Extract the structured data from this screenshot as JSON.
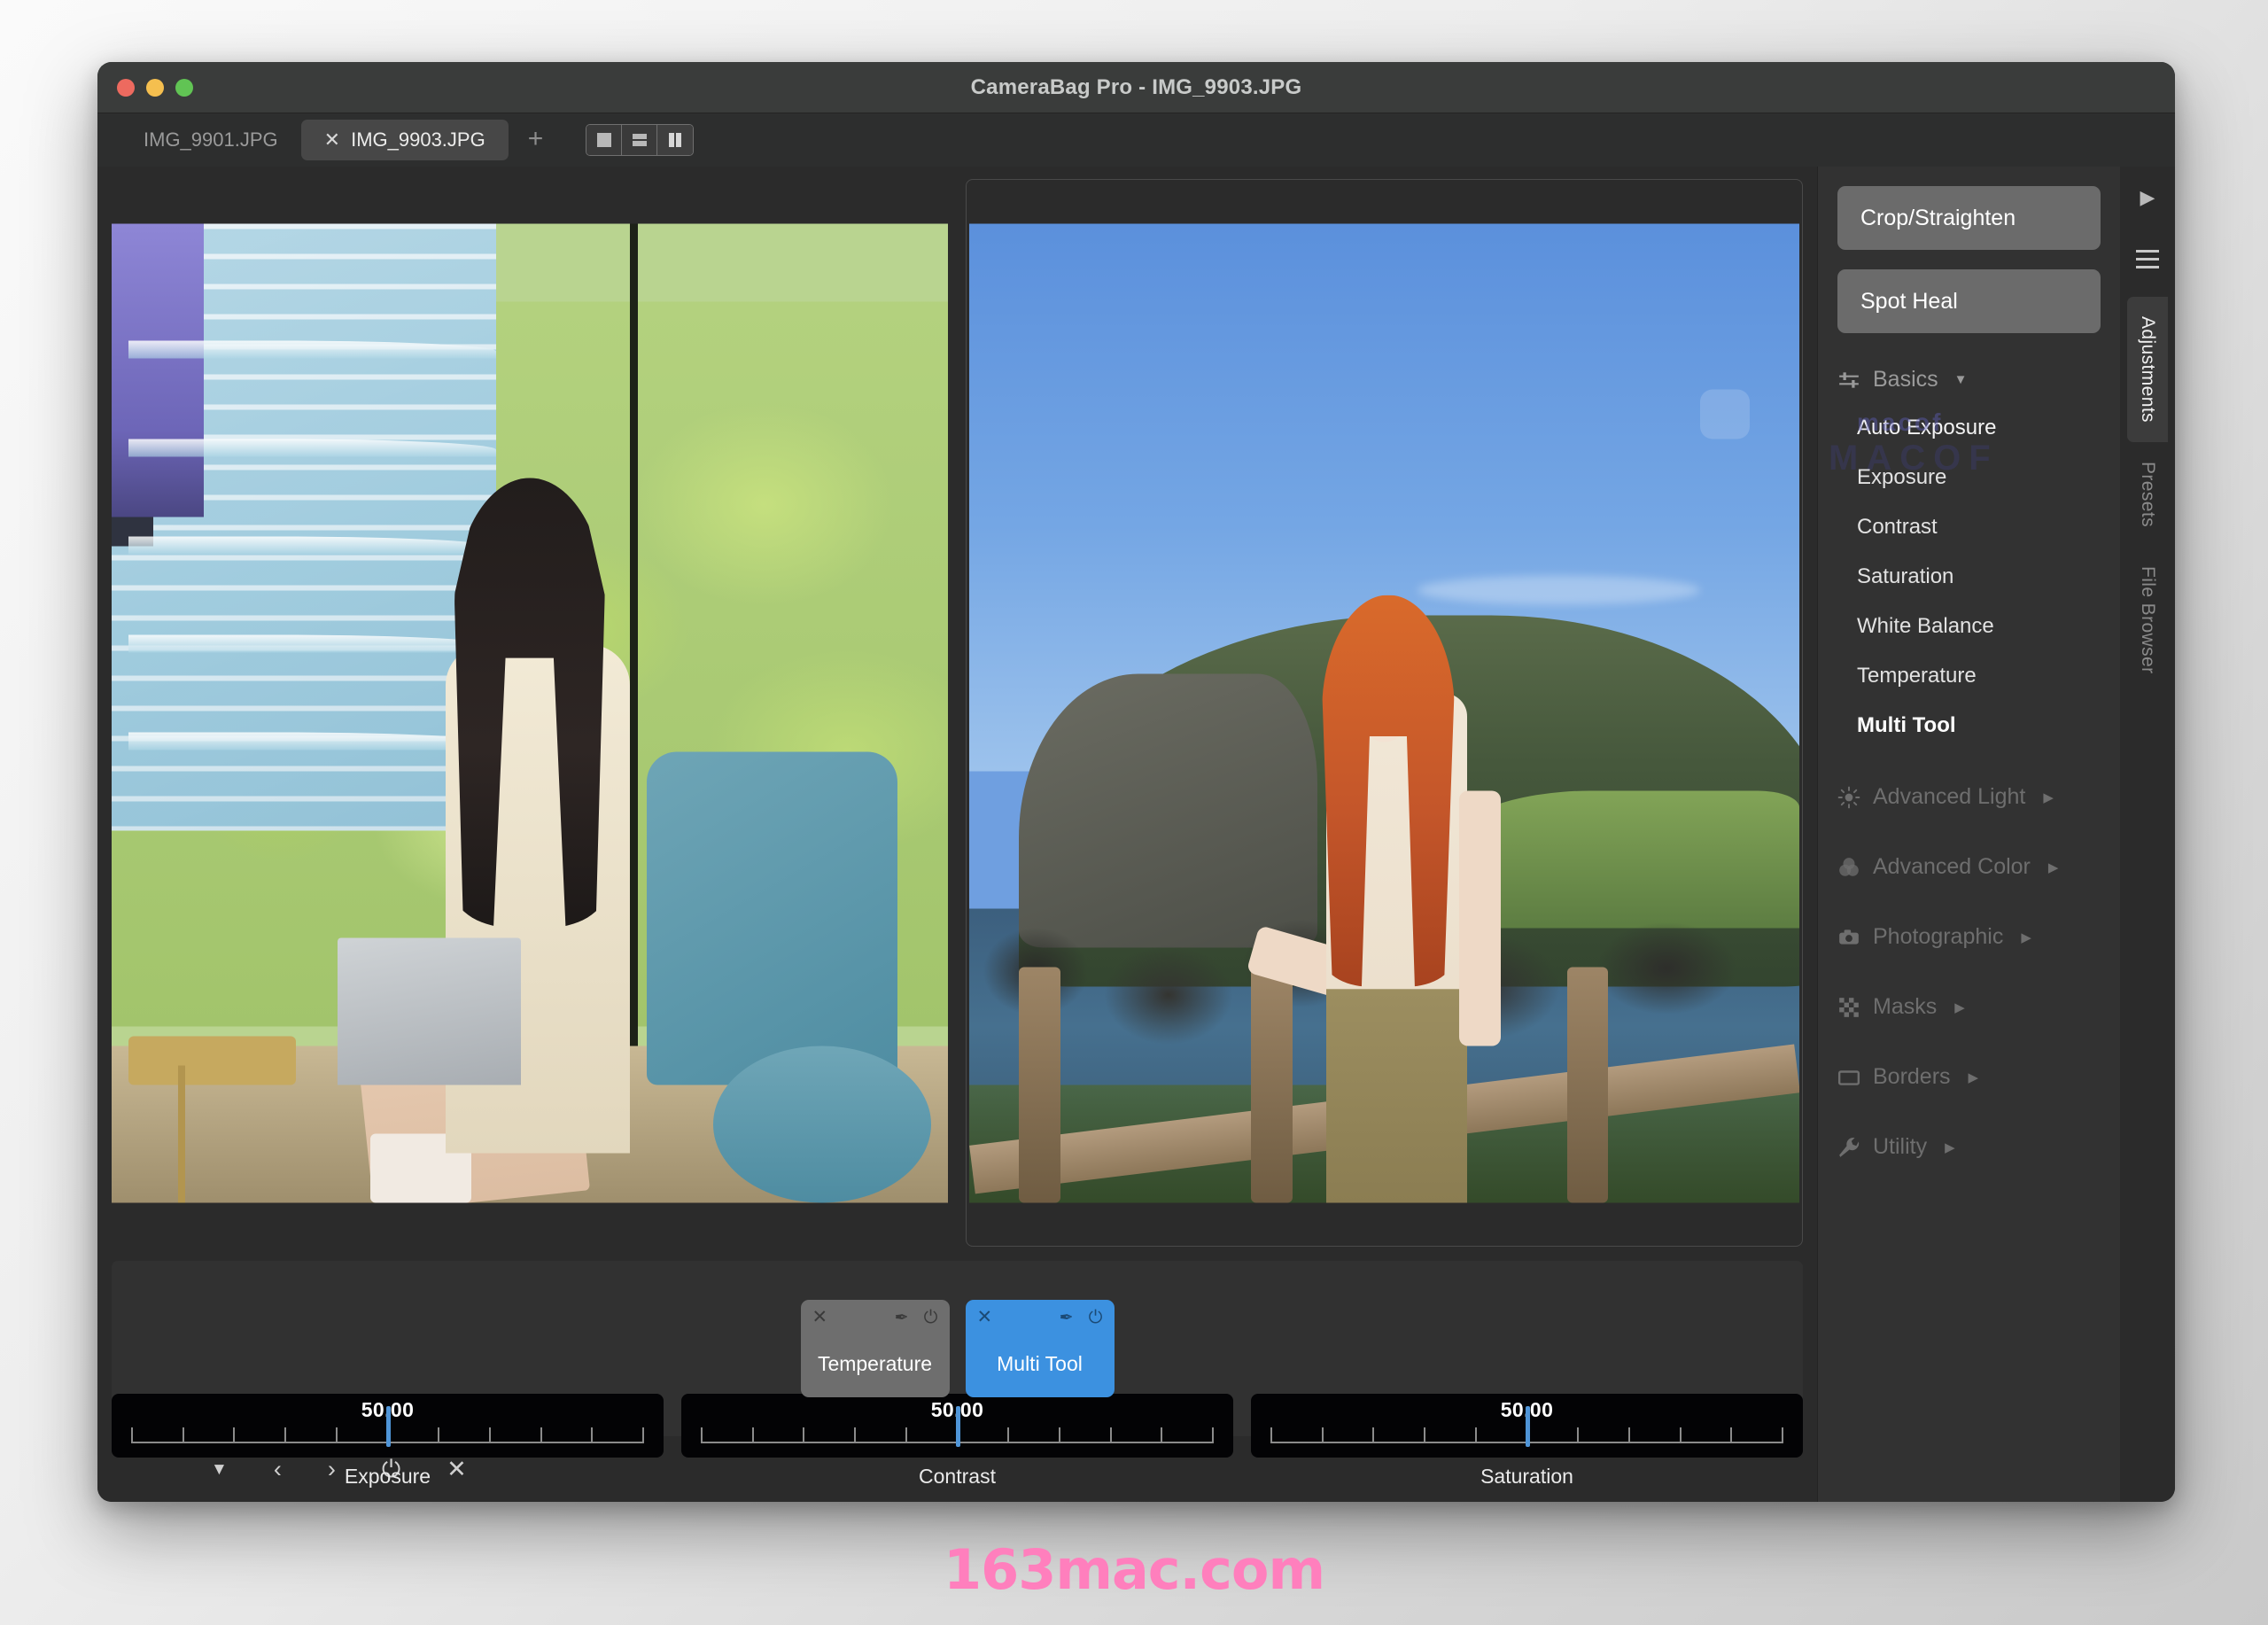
{
  "window": {
    "title": "CameraBag Pro - IMG_9903.JPG",
    "traffic_lights": {
      "close": "close",
      "minimize": "minimize",
      "maximize": "maximize"
    }
  },
  "tabs": {
    "items": [
      {
        "label": "IMG_9901.JPG",
        "active": false,
        "closable": false
      },
      {
        "label": "IMG_9903.JPG",
        "active": true,
        "closable": true,
        "close_glyph": "✕"
      }
    ],
    "add_label": "+",
    "layout_buttons": [
      {
        "name": "single-pane",
        "active": false
      },
      {
        "name": "horizontal-split",
        "active": false
      },
      {
        "name": "vertical-split",
        "active": true
      }
    ]
  },
  "sliders": [
    {
      "label": "Exposure",
      "value": "50.00",
      "position_pct": 50,
      "ticks": 11
    },
    {
      "label": "Contrast",
      "value": "50.00",
      "position_pct": 50,
      "ticks": 11
    },
    {
      "label": "Saturation",
      "value": "50.00",
      "position_pct": 50,
      "ticks": 11
    }
  ],
  "dock": {
    "chips": [
      {
        "label": "Temperature",
        "active": false,
        "close_glyph": "✕",
        "pin_glyph": "✒",
        "power_glyph": "⏻"
      },
      {
        "label": "Multi Tool",
        "active": true,
        "close_glyph": "✕",
        "pin_glyph": "✒",
        "power_glyph": "⏻"
      }
    ]
  },
  "bottom_bar": {
    "buttons": [
      {
        "name": "collapse-caret",
        "glyph": "▼"
      },
      {
        "name": "previous",
        "glyph": "‹"
      },
      {
        "name": "next",
        "glyph": "›"
      },
      {
        "name": "power-toggle",
        "glyph": "⏻"
      },
      {
        "name": "close",
        "glyph": "✕"
      }
    ]
  },
  "right_panel": {
    "tools": [
      {
        "label": "Crop/Straighten"
      },
      {
        "label": "Spot Heal"
      }
    ],
    "groups": [
      {
        "label": "Basics",
        "icon": "sliders-icon",
        "expanded": true,
        "caret": "▼",
        "items": [
          {
            "label": "Auto Exposure",
            "state": "accent",
            "watermark": "macof",
            "watermark2": "MACOF"
          },
          {
            "label": "Exposure",
            "state": "normal"
          },
          {
            "label": "Contrast",
            "state": "normal"
          },
          {
            "label": "Saturation",
            "state": "normal"
          },
          {
            "label": "White Balance",
            "state": "normal"
          },
          {
            "label": "Temperature",
            "state": "normal"
          },
          {
            "label": "Multi Tool",
            "state": "bold"
          }
        ]
      },
      {
        "label": "Advanced Light",
        "icon": "sun-icon",
        "expanded": false,
        "caret": "▶"
      },
      {
        "label": "Advanced Color",
        "icon": "color-circles-icon",
        "expanded": false,
        "caret": "▶"
      },
      {
        "label": "Photographic",
        "icon": "camera-icon",
        "expanded": false,
        "caret": "▶"
      },
      {
        "label": "Masks",
        "icon": "checkerboard-icon",
        "expanded": false,
        "caret": "▶"
      },
      {
        "label": "Borders",
        "icon": "rectangle-icon",
        "expanded": false,
        "caret": "▶"
      },
      {
        "label": "Utility",
        "icon": "wrench-icon",
        "expanded": false,
        "caret": "▶"
      }
    ]
  },
  "right_rail": {
    "play_glyph": "▶",
    "tabs": [
      {
        "label": "Adjustments",
        "active": true
      },
      {
        "label": "Presets",
        "active": false
      },
      {
        "label": "File Browser",
        "active": false
      }
    ]
  },
  "watermark": {
    "text": "163mac.com",
    "color": "#ff7fbd"
  },
  "colors": {
    "accent_blue": "#3c91e0",
    "slider_thumb": "#4f95d8",
    "window_bg": "#2b2b2b",
    "panel_bg": "#323232",
    "titlebar_bg": "#3a3c3b"
  }
}
